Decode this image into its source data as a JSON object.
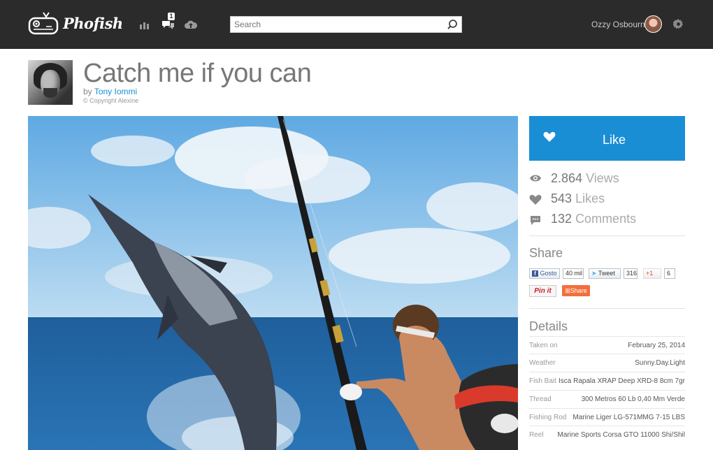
{
  "header": {
    "logo_text": "Phofish",
    "notification_count": "1",
    "search_placeholder": "Search",
    "user_name": "Ozzy Osbourne"
  },
  "photo_page": {
    "title": "Catch me if you can",
    "by_label": "by",
    "author": "Tony Iommi",
    "copyright": "© Copyright Alexine"
  },
  "sidebar": {
    "like_label": "Like",
    "stats": [
      {
        "number": "2.864",
        "unit": "Views",
        "icon": "eye-icon"
      },
      {
        "number": "543",
        "unit": "Likes",
        "icon": "heart-icon"
      },
      {
        "number": "132",
        "unit": "Comments",
        "icon": "comment-icon"
      }
    ],
    "share_title": "Share",
    "share": {
      "facebook_label": "Gosto",
      "facebook_count": "40 mil",
      "twitter_label": "Tweet",
      "twitter_count": "316",
      "gplus_label": "+1",
      "gplus_count": "6",
      "pinterest_label": "Pin it",
      "share_label": "Share"
    },
    "details_title": "Details",
    "details": [
      {
        "key": "Taken on",
        "value": "February 25, 2014"
      },
      {
        "key": "Weather",
        "value": "Sunny.Day.Light"
      },
      {
        "key": "Fish Bait",
        "value": "Isca Rapala XRAP Deep XRD-8 8cm 7gr"
      },
      {
        "key": "Thread",
        "value": "300 Metros 60 Lb 0,40 Mm Verde"
      },
      {
        "key": "Fishing Rod",
        "value": "Marine Liger LG-571MMG 7-15 LBS"
      },
      {
        "key": "Reel",
        "value": "Marine Sports Corsa GTO 11000 Shi/Shil"
      }
    ]
  },
  "colors": {
    "topbar": "#2b2b2b",
    "accent": "#1a8ed4",
    "share_orange": "#f26f3c"
  }
}
